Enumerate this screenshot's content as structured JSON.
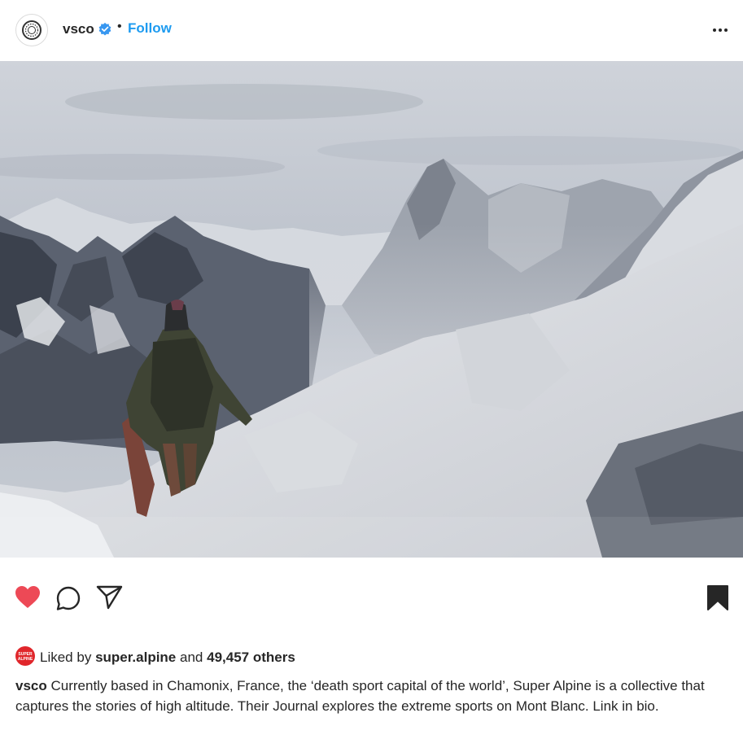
{
  "header": {
    "username": "vsco",
    "separator": "•",
    "follow_label": "Follow",
    "avatar_icon": "vsco-logo-icon",
    "verified_icon": "verified-badge-icon",
    "more_icon": "more-options-icon"
  },
  "post": {
    "image_icon": "mountain-snowboarder-photo",
    "actions": {
      "like_icon": "heart-icon",
      "like_state": "liked",
      "comment_icon": "comment-icon",
      "share_icon": "share-icon",
      "save_icon": "bookmark-icon"
    },
    "likes": {
      "avatar_text": "SUPER ALPINE",
      "prefix": "Liked by",
      "user": "super.alpine",
      "middle": "and",
      "count": "49,457 others"
    },
    "caption": {
      "user": "vsco",
      "text": "Currently based in Chamonix, France, the ‘death sport capital of the world’, Super Alpine is a collective that captures the stories of high altitude. Their Journal explores the extreme sports on Mont Blanc. Link in bio."
    }
  },
  "colors": {
    "accent": "#1d9bf0",
    "like": "#ed4956",
    "text": "#262626"
  }
}
